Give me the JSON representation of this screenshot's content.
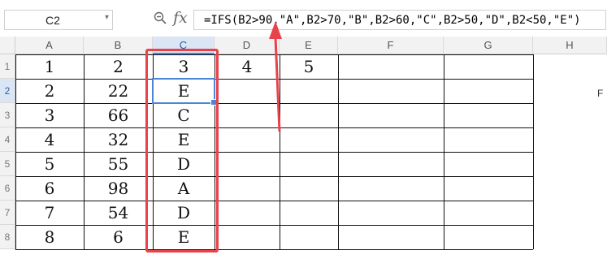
{
  "formula_bar": {
    "name_box": "C2",
    "formula": "=IFS(B2>90,\"A\",B2>70,\"B\",B2>60,\"C\",B2>50,\"D\",B2<50,\"E\")"
  },
  "columns": [
    "A",
    "B",
    "C",
    "D",
    "E",
    "F",
    "G",
    "H"
  ],
  "rows": [
    "1",
    "2",
    "3",
    "4",
    "5",
    "6",
    "7",
    "8"
  ],
  "cells": [
    [
      "1",
      "2",
      "3",
      "4",
      "5"
    ],
    [
      "2",
      "22",
      "E"
    ],
    [
      "3",
      "66",
      "C"
    ],
    [
      "4",
      "32",
      "E"
    ],
    [
      "5",
      "55",
      "D"
    ],
    [
      "6",
      "98",
      "A"
    ],
    [
      "7",
      "54",
      "D"
    ],
    [
      "8",
      "6",
      "E"
    ]
  ],
  "offscreen_text": "F",
  "colors": {
    "selection": "#4a86d4",
    "highlight_box": "#e8424a",
    "arrow": "#e8424a"
  }
}
